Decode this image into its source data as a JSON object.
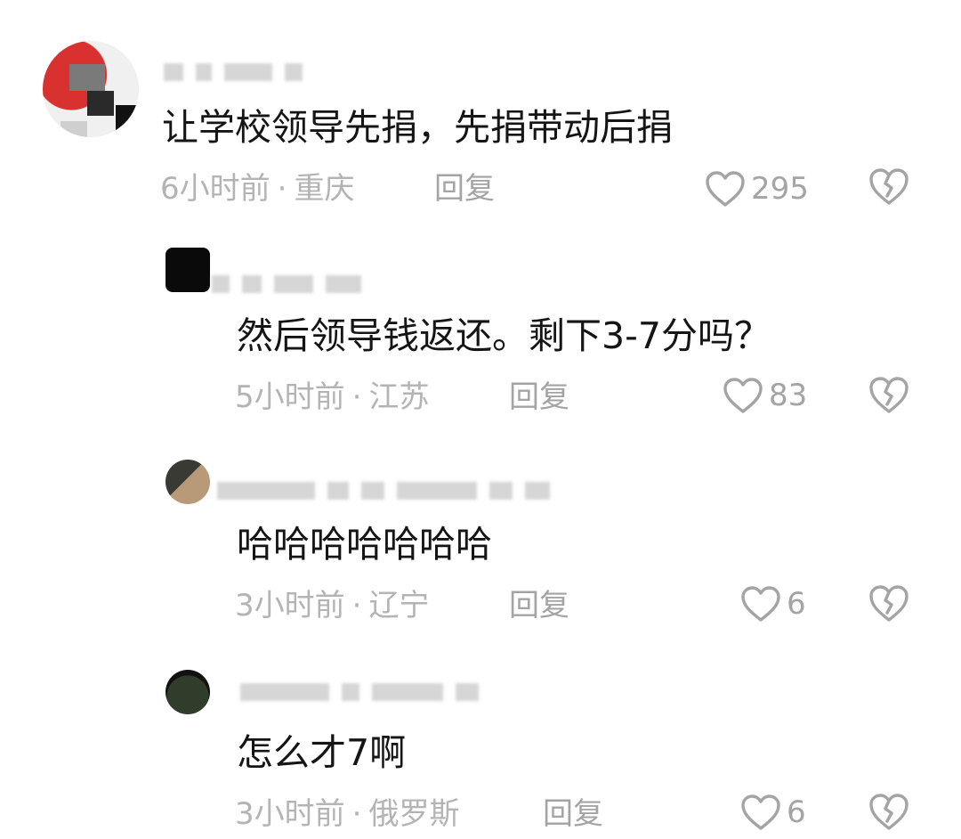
{
  "comments": [
    {
      "content": "让学校领导先捐，先捐带动后捐",
      "time": "6小时前",
      "location": "重庆",
      "reply_label": "回复",
      "likes": "295",
      "like_icon": "heart-outline-icon",
      "dislike_icon": "broken-heart-icon"
    },
    {
      "content": "然后领导钱返还。剩下3-7分吗？",
      "time": "5小时前",
      "location": "江苏",
      "reply_label": "回复",
      "likes": "83",
      "like_icon": "heart-outline-icon",
      "dislike_icon": "broken-heart-icon"
    },
    {
      "content": "哈哈哈哈哈哈哈",
      "time": "3小时前",
      "location": "辽宁",
      "reply_label": "回复",
      "likes": "6",
      "like_icon": "heart-outline-icon",
      "dislike_icon": "broken-heart-icon"
    },
    {
      "content": "怎么才7啊",
      "time": "3小时前",
      "location": "俄罗斯",
      "reply_label": "回复",
      "likes": "6",
      "like_icon": "heart-outline-icon",
      "dislike_icon": "broken-heart-icon"
    }
  ],
  "meta_separator": "·",
  "colors": {
    "text": "#151515",
    "meta": "#b4b4b4",
    "icon": "#a4a4a4"
  }
}
